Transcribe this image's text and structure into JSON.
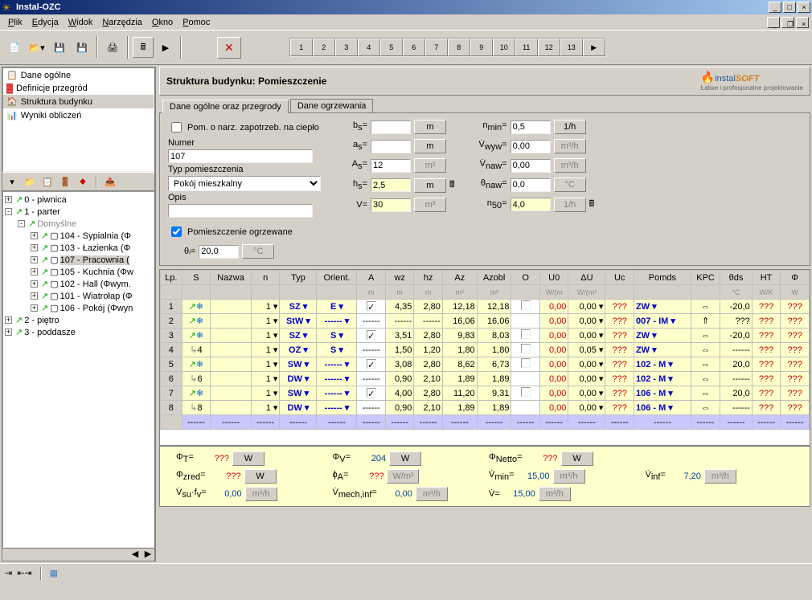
{
  "window": {
    "title": "Instal-OZC"
  },
  "menu": [
    "Plik",
    "Edycja",
    "Widok",
    "Narzędzia",
    "Okno",
    "Pomoc"
  ],
  "nav": {
    "items": [
      {
        "label": "Dane ogólne"
      },
      {
        "label": "Definicje przegród"
      },
      {
        "label": "Struktura budynku",
        "selected": true
      },
      {
        "label": "Wyniki obliczeń"
      }
    ]
  },
  "tree": [
    {
      "depth": 0,
      "exp": "+",
      "label": "0 - piwnica"
    },
    {
      "depth": 0,
      "exp": "-",
      "label": "1 - parter"
    },
    {
      "depth": 1,
      "exp": "-",
      "label": "Domyślne",
      "gray": true
    },
    {
      "depth": 2,
      "exp": "+",
      "label": "104 - Sypialnia (Φ"
    },
    {
      "depth": 2,
      "exp": "+",
      "label": "103 - Łazienka (Φ"
    },
    {
      "depth": 2,
      "exp": "+",
      "label": "107 - Pracownia (",
      "selected": true
    },
    {
      "depth": 2,
      "exp": "+",
      "label": "105 - Kuchnia (Φw"
    },
    {
      "depth": 2,
      "exp": "+",
      "label": "102 - Hall (Φwym."
    },
    {
      "depth": 2,
      "exp": "+",
      "label": "101 - Wiatrołap (Φ"
    },
    {
      "depth": 2,
      "exp": "+",
      "label": "106 - Pokój (Φwyn"
    },
    {
      "depth": 0,
      "exp": "+",
      "label": "2 - piętro"
    },
    {
      "depth": 0,
      "exp": "+",
      "label": "3 - poddasze"
    }
  ],
  "header": {
    "title": "Struktura budynku: Pomieszczenie"
  },
  "tabs": [
    {
      "label": "Dane ogólne oraz przegrody",
      "active": true
    },
    {
      "label": "Dane ogrzewania"
    }
  ],
  "form": {
    "chk_pom": "Pom. o narz. zapotrzeb. na ciepło",
    "numer_lbl": "Numer",
    "numer": "107",
    "typ_lbl": "Typ pomieszczenia",
    "typ": "Pokój mieszkalny",
    "opis_lbl": "Opis",
    "opis": "",
    "chk_ogrz": "Pomieszczenie ogrzewane",
    "theta_i_lbl": "θᵢ=",
    "theta_i": "20,0",
    "theta_i_unit": "°C",
    "bs": "",
    "as": "",
    "As": "12",
    "hs": "2,5",
    "V": "30",
    "nmin": "0,5",
    "Vwyw": "0,00",
    "Vnaw": "0,00",
    "theta_naw": "0,0",
    "n50": "4,0"
  },
  "gridhead": [
    "Lp.",
    "S",
    "Nazwa",
    "n",
    "Typ",
    "Orient.",
    "A",
    "wz",
    "hz",
    "Az",
    "Azobl",
    "O",
    "U0",
    "ΔU",
    "Uc",
    "Pomds",
    "KPC",
    "θds",
    "HT",
    "Φ"
  ],
  "gridunits": [
    "",
    "",
    "",
    "",
    "",
    "",
    "m",
    "m",
    "m",
    "m²",
    "m²",
    "",
    "W/(m",
    "W/(m²",
    "",
    "",
    "",
    "°C",
    "W/K",
    "W"
  ],
  "rows": [
    {
      "lp": "1",
      "n": "1",
      "typ": "SZ",
      "orient": "E",
      "chk": true,
      "A": "4,35",
      "wz": "2,80",
      "Az": "12,18",
      "Azobl": "12,18",
      "O": false,
      "U0": "0,00",
      "dU": "0,00",
      "Uc": "???",
      "pom": "ZW",
      "theta": "-20,0",
      "HT": "???",
      "Phi": "???"
    },
    {
      "lp": "2",
      "n": "1",
      "typ": "StW",
      "orient": "------",
      "A": "------",
      "wz": "------",
      "Az": "16,06",
      "Azobl": "16,06",
      "U0": "0,00",
      "dU": "0,00",
      "Uc": "???",
      "pom": "007 - IM",
      "arrow": "⇑",
      "theta": "???",
      "HT": "???",
      "Phi": "???"
    },
    {
      "lp": "3",
      "n": "1",
      "typ": "SZ",
      "orient": "S",
      "chk": true,
      "A": "3,51",
      "wz": "2,80",
      "Az": "9,83",
      "Azobl": "8,03",
      "O": false,
      "U0": "0,00",
      "dU": "0,00",
      "Uc": "???",
      "pom": "ZW",
      "theta": "-20,0",
      "HT": "???",
      "Phi": "???"
    },
    {
      "lp": "4",
      "sub": "4",
      "n": "1",
      "typ": "OZ",
      "orient": "S",
      "A": "1,50",
      "wz": "1,20",
      "Az": "1,80",
      "Azobl": "1,80",
      "O": false,
      "U0": "0,00",
      "dU": "0,05",
      "Uc": "???",
      "pom": "ZW",
      "theta": "------",
      "HT": "???",
      "Phi": "???"
    },
    {
      "lp": "5",
      "n": "1",
      "typ": "SW",
      "orient": "------",
      "chk": true,
      "A": "3,08",
      "wz": "2,80",
      "Az": "8,62",
      "Azobl": "6,73",
      "O": false,
      "U0": "0,00",
      "dU": "0,00",
      "Uc": "???",
      "pom": "102 - M",
      "theta": "20,0",
      "HT": "???",
      "Phi": "???"
    },
    {
      "lp": "6",
      "sub": "6",
      "n": "1",
      "typ": "DW",
      "orient": "------",
      "A": "0,90",
      "wz": "2,10",
      "Az": "1,89",
      "Azobl": "1,89",
      "U0": "0,00",
      "dU": "0,00",
      "Uc": "???",
      "pom": "102 - M",
      "theta": "------",
      "HT": "???",
      "Phi": "???"
    },
    {
      "lp": "7",
      "n": "1",
      "typ": "SW",
      "orient": "------",
      "chk": true,
      "A": "4,00",
      "wz": "2,80",
      "Az": "11,20",
      "Azobl": "9,31",
      "O": false,
      "U0": "0,00",
      "dU": "0,00",
      "Uc": "???",
      "pom": "106 - M",
      "theta": "20,0",
      "HT": "???",
      "Phi": "???"
    },
    {
      "lp": "8",
      "sub": "8",
      "n": "1",
      "typ": "DW",
      "orient": "------",
      "A": "0,90",
      "wz": "2,10",
      "Az": "1,89",
      "Azobl": "1,89",
      "U0": "0,00",
      "dU": "0,00",
      "Uc": "???",
      "pom": "106 - M",
      "theta": "------",
      "HT": "???",
      "Phi": "???"
    }
  ],
  "summary": {
    "PhiT": "???",
    "PhiV": "204",
    "PhiNetto": "???",
    "Phizred": "???",
    "phiA": "???",
    "Vmin": "15,00",
    "Vinf": "7,20",
    "Vsufv": "0,00",
    "Vmechinf": "0,00",
    "V": "15,00"
  }
}
